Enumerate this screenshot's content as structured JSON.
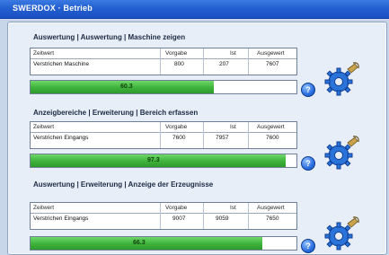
{
  "window": {
    "title": "SWERDOX · Betrieb"
  },
  "sections": [
    {
      "title": "Auswertung | Auswertung | Maschine zeigen",
      "table": {
        "headers": [
          "Zeitwert",
          "Vorgabe",
          "Ist",
          "Ausgewert"
        ],
        "row": [
          "Verstrichen Maschine",
          "800",
          "207",
          "7607"
        ]
      },
      "progress": {
        "label": "60.3",
        "fraction": 0.69
      }
    },
    {
      "title": "Anzeigbereiche | Erweiterung | Bereich erfassen",
      "table": {
        "headers": [
          "Zeitwert",
          "Vorgabe",
          "Ist",
          "Ausgewert"
        ],
        "row": [
          "Verstrichen Eingangs",
          "7600",
          "7957",
          "7600"
        ]
      },
      "progress": {
        "label": "97.3",
        "fraction": 0.96
      }
    },
    {
      "title": "Auswertung | Erweiterung | Anzeige der Erzeugnisse",
      "table": {
        "headers": [
          "Zeitwert",
          "Vorgabe",
          "Ist",
          "Ausgewert"
        ],
        "row": [
          "Verstrichen Eingangs",
          "9007",
          "9059",
          "7650"
        ]
      },
      "progress": {
        "label": "66.3",
        "fraction": 0.87
      }
    }
  ],
  "icons": {
    "help": "help-icon",
    "settings": "gear-icon",
    "help_glyph": "?"
  }
}
